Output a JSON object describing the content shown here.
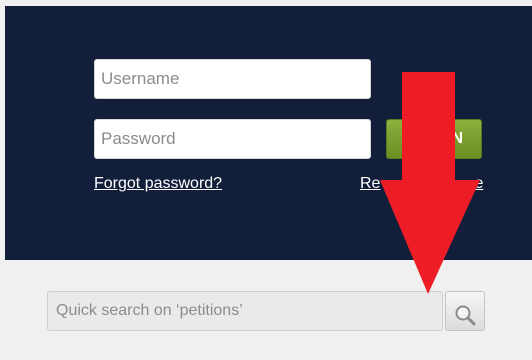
{
  "login": {
    "username_placeholder": "Username",
    "password_placeholder": "Password",
    "login_button_label": "N",
    "forgot_password_label": "Forgot password?",
    "register_label_visible_left": "Re",
    "register_label_visible_right": "e"
  },
  "search": {
    "placeholder": "Quick search on ‘petitions’",
    "icon": "search-icon"
  },
  "annotation": {
    "arrow_color": "#ee1c24",
    "icon": "arrow-down-icon"
  },
  "colors": {
    "panel_background": "#131f3a",
    "login_button": "#7aa22f"
  }
}
